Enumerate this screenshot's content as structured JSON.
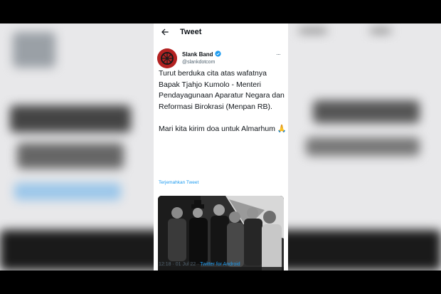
{
  "header": {
    "title": "Tweet"
  },
  "tweet": {
    "author_name": "Slank Band",
    "author_handle": "@slankdotcom",
    "more": "···",
    "text": "Turut berduka cita atas wafatnya Bapak Tjahjo Kumolo - Menteri Pendayagunaan Aparatur Negara dan Reformasi Birokrasi (Menpan RB).\n\nMari kita kirim doa untuk Almarhum 🙏",
    "translate_label": "Terjemahkan Tweet",
    "time": "12:18 · 01 Jul 22",
    "source_sep": " · ",
    "source": "Twitter for Android"
  },
  "colors": {
    "accent": "#1d9bf0",
    "avatar": "#b32222",
    "text": "#0f1419",
    "muted": "#536471"
  },
  "icons": {
    "back": "arrow-left-icon",
    "verified": "verified-badge-icon",
    "more": "more-horizontal-icon"
  }
}
